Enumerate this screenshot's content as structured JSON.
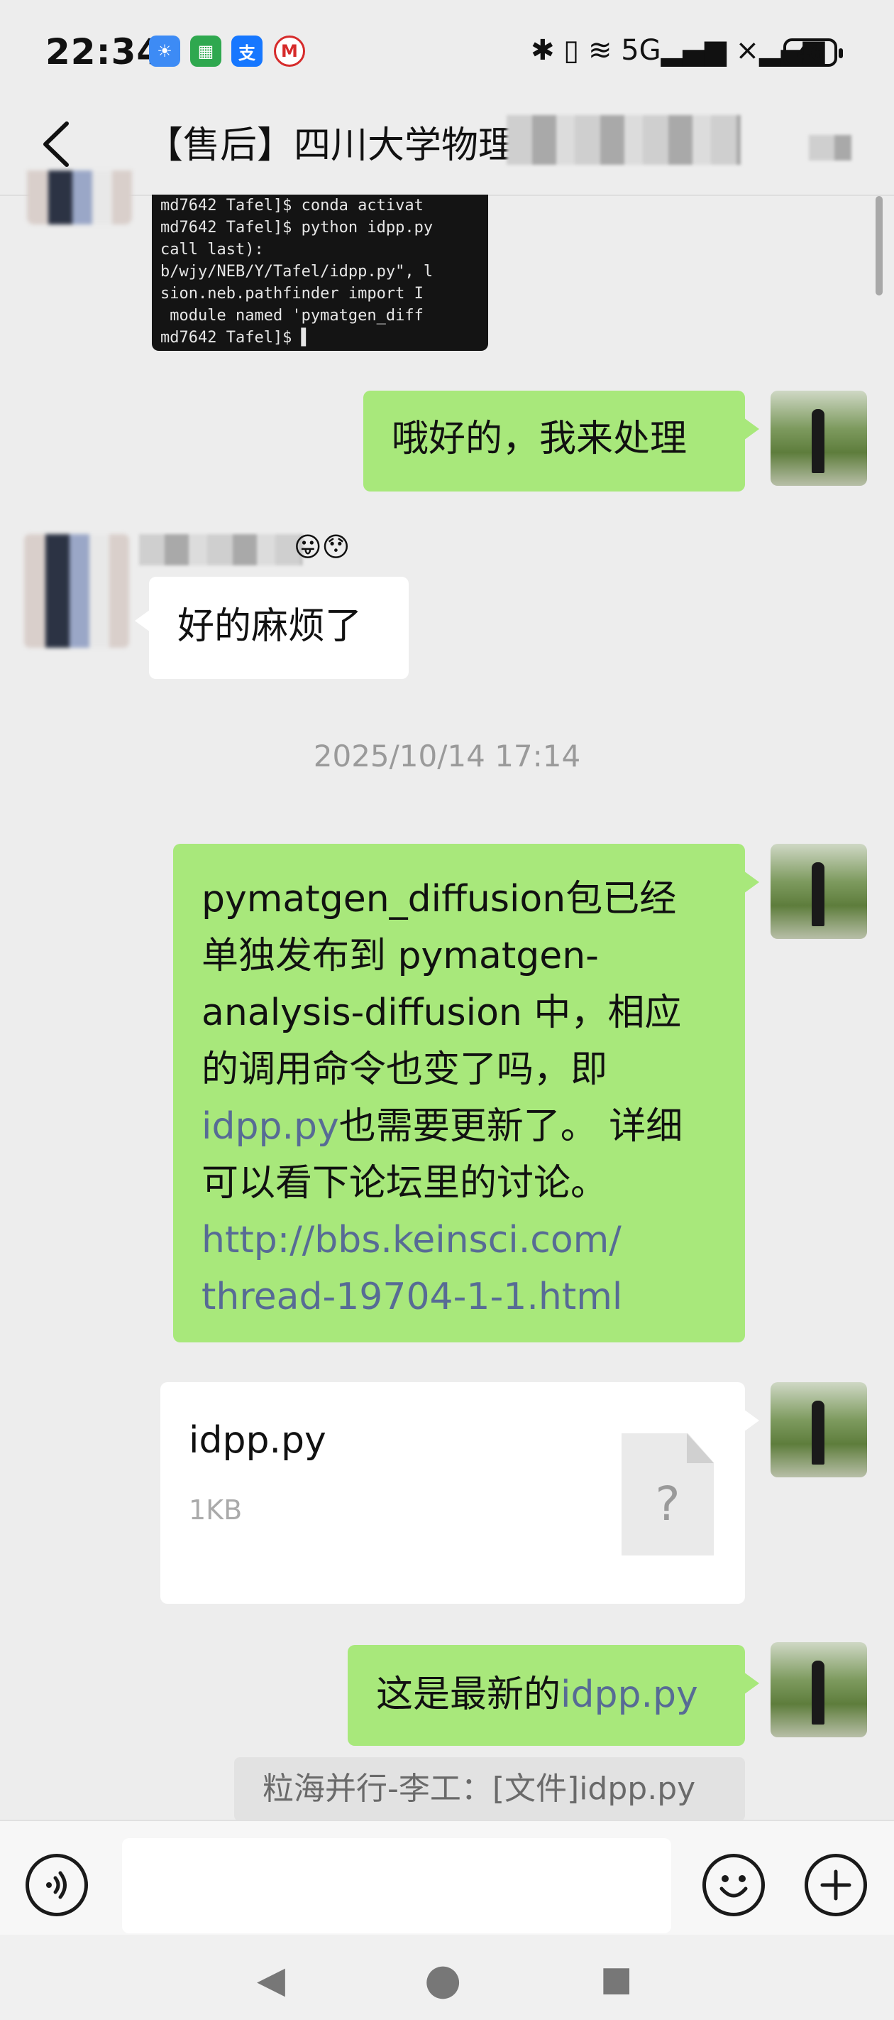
{
  "status_bar": {
    "time": "22:34",
    "app_icons": [
      {
        "name": "weather-app-icon",
        "glyph": "☀",
        "color": "#3d8bf5"
      },
      {
        "name": "health-app-icon",
        "glyph": "▦",
        "color": "#2fa84f"
      },
      {
        "name": "alipay-app-icon",
        "glyph": "支",
        "color": "#1677ff"
      },
      {
        "name": "bank-app-icon",
        "glyph": "M",
        "color": "#d62b2b"
      }
    ],
    "signal_text": "✱ ▯ ≋ 5G▂▄▆ ×▂▄▆",
    "battery": "46"
  },
  "header": {
    "title": "【售后】四川大学物理"
  },
  "terminal_lines": [
    "md7642 Tafel]$ conda activat",
    "md7642 Tafel]$ python idpp.py",
    "call last):",
    "b/wjy/NEB/Y/Tafel/idpp.py\", l",
    "sion.neb.pathfinder import I",
    " module named 'pymatgen_diff",
    "md7642 Tafel]$ ▌"
  ],
  "messages": {
    "msg1": "哦好的，我来处理",
    "msg2_sender_emoji": "😛😯",
    "msg2": "好的麻烦了",
    "timestamp": "2025/10/14 17:14",
    "msg3_lines": [
      {
        "text": "pymatgen_diffusion包已经",
        "link": false
      },
      {
        "text": "单独发布到 pymatgen-",
        "link": false
      },
      {
        "text": "analysis-diffusion 中，相应",
        "link": false
      },
      {
        "text": "的调用命令也变了吗，即",
        "link": false
      }
    ],
    "msg3_line5_link": "idpp.py",
    "msg3_line5_rest": "也需要更新了。 详细",
    "msg3_line6": "可以看下论坛里的讨论。",
    "msg3_url_1": "http://bbs.keinsci.com/",
    "msg3_url_2": "thread-19704-1-1.html",
    "file_name": "idpp.py",
    "file_size": "1KB",
    "file_icon": "?",
    "msg5_text": "这是最新的",
    "msg5_link": "idpp.py",
    "quote": "粒海并行-李工：[文件]idpp.py"
  },
  "icons": {
    "back": "back-chevron-icon",
    "voice": "voice-icon",
    "emoji": "emoji-icon",
    "plus": "plus-icon"
  },
  "nav": {
    "back": "◀",
    "home": "●",
    "recent": "■"
  }
}
